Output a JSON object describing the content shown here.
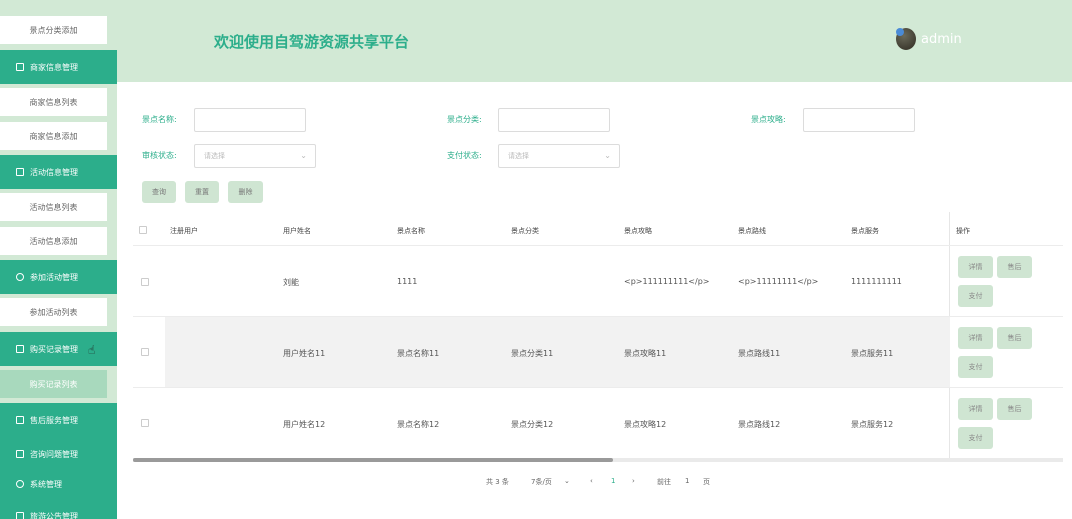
{
  "sidebar": {
    "items": [
      {
        "type": "sub",
        "label": "景点分类添加"
      },
      {
        "type": "group",
        "label": "商家信息管理",
        "icon": "checkbox-icon"
      },
      {
        "type": "sub",
        "label": "商家信息列表"
      },
      {
        "type": "sub",
        "label": "商家信息添加"
      },
      {
        "type": "group",
        "label": "活动信息管理",
        "icon": "edit-icon"
      },
      {
        "type": "sub",
        "label": "活动信息列表"
      },
      {
        "type": "sub",
        "label": "活动信息添加"
      },
      {
        "type": "group",
        "label": "参加活动管理",
        "icon": "diamond-icon"
      },
      {
        "type": "sub",
        "label": "参加活动列表"
      },
      {
        "type": "group",
        "label": "购买记录管理",
        "icon": "checkbox-icon"
      },
      {
        "type": "active",
        "label": "购买记录列表"
      },
      {
        "type": "group",
        "label": "售后服务管理",
        "icon": "square-icon"
      },
      {
        "type": "group",
        "label": "咨询问题管理",
        "icon": "edit-icon"
      },
      {
        "type": "group",
        "label": "系统管理",
        "icon": "diamond-icon"
      },
      {
        "type": "group",
        "label": "旅游公告管理",
        "icon": "edit-icon"
      }
    ]
  },
  "header": {
    "title": "欢迎使用自驾游资源共享平台",
    "user": "admin"
  },
  "search": {
    "scenic_name_label": "景点名称:",
    "scenic_category_label": "景点分类:",
    "scenic_guide_label": "景点攻略:",
    "review_status_label": "审核状态:",
    "review_status_placeholder": "请选择",
    "pay_status_label": "支付状态:",
    "pay_status_placeholder": "请选择",
    "query_button": "查询",
    "reset_button": "重置",
    "delete_button": "删除"
  },
  "table": {
    "headers": [
      "注册用户",
      "用户姓名",
      "景点名称",
      "景点分类",
      "景点攻略",
      "景点路线",
      "景点服务",
      "操作"
    ],
    "rows": [
      [
        "",
        "刘能",
        "1111",
        "",
        "<p>111111111</p>",
        "<p>11111111</p>",
        "1111111111"
      ],
      [
        "",
        "用户姓名11",
        "景点名称11",
        "景点分类11",
        "景点攻略11",
        "景点路线11",
        "景点服务11"
      ],
      [
        "",
        "用户姓名12",
        "景点名称12",
        "景点分类12",
        "景点攻略12",
        "景点路线12",
        "景点服务12"
      ]
    ],
    "action_detail": "详情",
    "action_aftersale": "售后",
    "action_pay": "支付"
  },
  "pagination": {
    "total": "共 3 条",
    "page_size": "7条/页",
    "current_page": "1",
    "goto_label": "前往",
    "goto_value": "1",
    "page_suffix": "页"
  },
  "colors": {
    "accent": "#2cae8b",
    "header_bg": "#d2e9d5",
    "button_bg": "#cfe5d2"
  }
}
